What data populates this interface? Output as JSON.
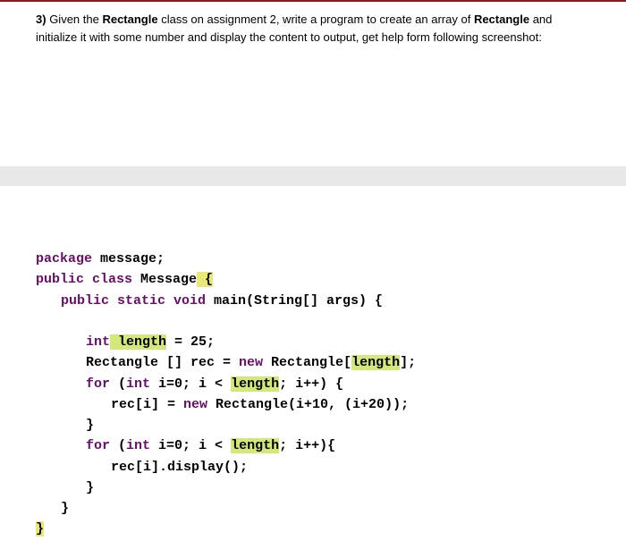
{
  "question": {
    "number": "3)",
    "text_part1": "Given the ",
    "bold1": "Rectangle",
    "text_part2": " class on assignment 2, write a program to create an array of ",
    "bold2": "Rectangle",
    "text_part3": " and initialize it with some number and display the content to output, get help form following screenshot:"
  },
  "code": {
    "l1_kw": "package",
    "l1_txt": " message;",
    "l2_kw1": "public",
    "l2_kw2": " class",
    "l2_name": " Message",
    "l2_brace": " {",
    "l3_kw": "public static void",
    "l3_txt": " main(String[] args) {",
    "l4_kw": "int",
    "l4_var": " length",
    "l4_rest": " = 25;",
    "l5_a": "Rectangle [] rec = ",
    "l5_kw": "new",
    "l5_b": " Rectangle[",
    "l5_len": "length",
    "l5_c": "];",
    "l6_kw": "for",
    "l6_a": " (",
    "l6_kw2": "int",
    "l6_b": " i=0; i < ",
    "l6_len": "length",
    "l6_c": "; i++) {",
    "l7_a": "rec[i] = ",
    "l7_kw": "new",
    "l7_b": " Rectangle(i+10, (i+20));",
    "l8": "}",
    "l9_kw": "for",
    "l9_a": " (",
    "l9_kw2": "int",
    "l9_b": " i=0; i < ",
    "l9_len": "length",
    "l9_c": "; i++){",
    "l10": "rec[i].display();",
    "l11": "}",
    "l12": "}",
    "l13": "}"
  }
}
